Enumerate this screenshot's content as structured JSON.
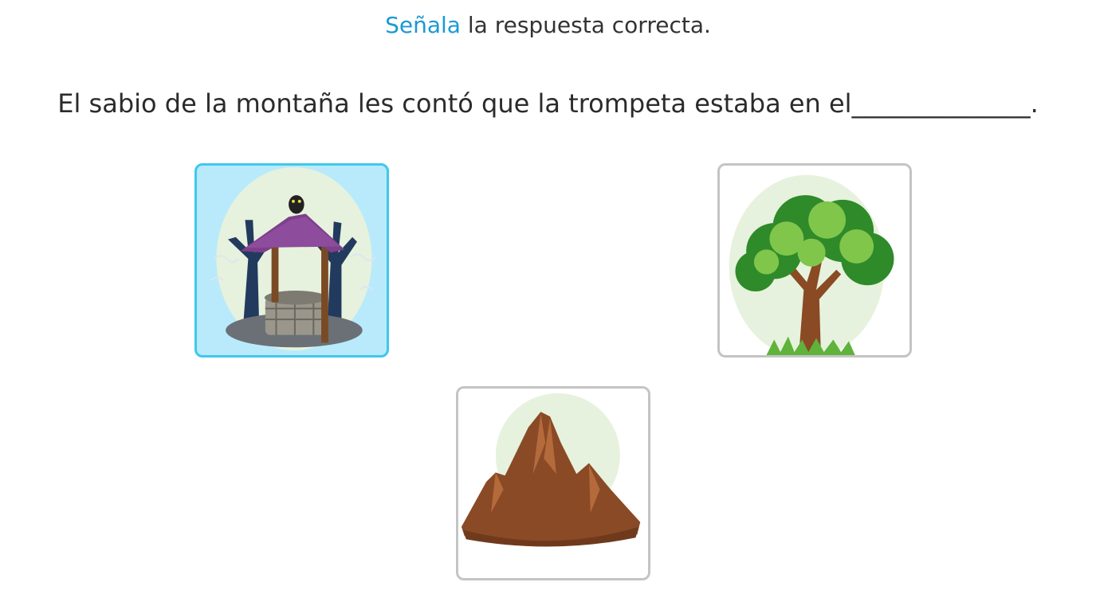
{
  "instruction": {
    "highlight": "Señala",
    "rest": " la respuesta correcta."
  },
  "question": {
    "text": "El sabio de la montaña les contó que la trompeta estaba en el______________."
  },
  "options": [
    {
      "name": "pozo",
      "icon": "well-icon",
      "selected": true
    },
    {
      "name": "arbol",
      "icon": "tree-icon",
      "selected": false
    },
    {
      "name": "montana",
      "icon": "mountain-icon",
      "selected": false
    }
  ],
  "colors": {
    "accent": "#1a99d4",
    "selected_border": "#3fc8ec",
    "selected_background": "#b8eafc",
    "card_border": "#c4c4c4"
  }
}
